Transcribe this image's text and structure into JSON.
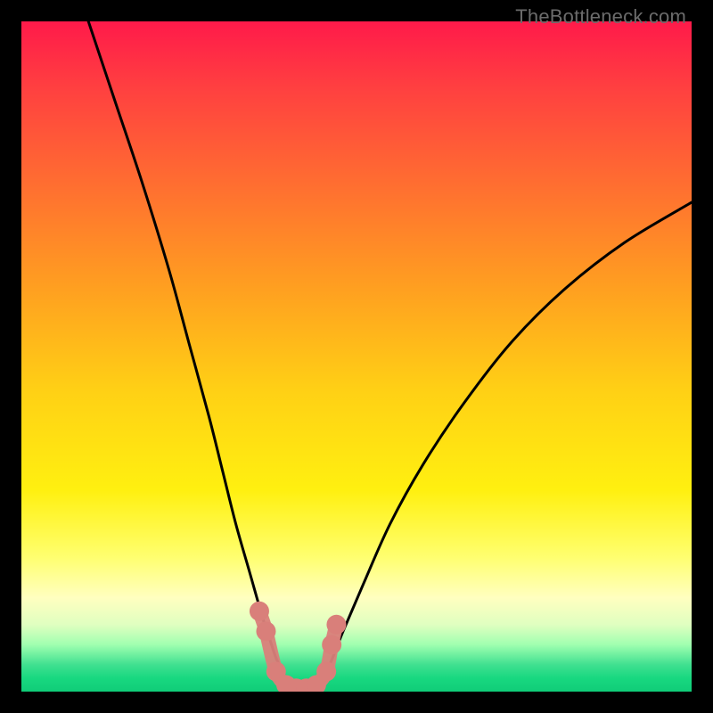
{
  "watermark": "TheBottleneck.com",
  "chart_data": {
    "type": "line",
    "title": "",
    "xlabel": "",
    "ylabel": "",
    "xlim": [
      0,
      100
    ],
    "ylim": [
      0,
      100
    ],
    "grid": false,
    "legend": false,
    "annotations": [],
    "series": [
      {
        "name": "left-curve",
        "color": "#000000",
        "x": [
          10,
          14,
          18,
          22,
          25,
          28,
          30,
          32,
          34,
          36,
          37,
          38,
          39,
          40
        ],
        "y": [
          100,
          88,
          76,
          63,
          52,
          41,
          33,
          25,
          18,
          11,
          8,
          5,
          3,
          0
        ]
      },
      {
        "name": "right-curve",
        "color": "#000000",
        "x": [
          44,
          46,
          48,
          51,
          55,
          60,
          66,
          73,
          81,
          90,
          100
        ],
        "y": [
          0,
          4,
          9,
          16,
          25,
          34,
          43,
          52,
          60,
          67,
          73
        ]
      },
      {
        "name": "bottom-dots",
        "type": "scatter",
        "color": "#d97f7a",
        "x": [
          35.5,
          36.5,
          38.0,
          39.5,
          41.0,
          42.5,
          44.0,
          45.5,
          46.3,
          47.0
        ],
        "y": [
          12,
          9,
          3,
          1,
          0.5,
          0.5,
          1,
          3,
          7,
          10
        ]
      }
    ]
  }
}
